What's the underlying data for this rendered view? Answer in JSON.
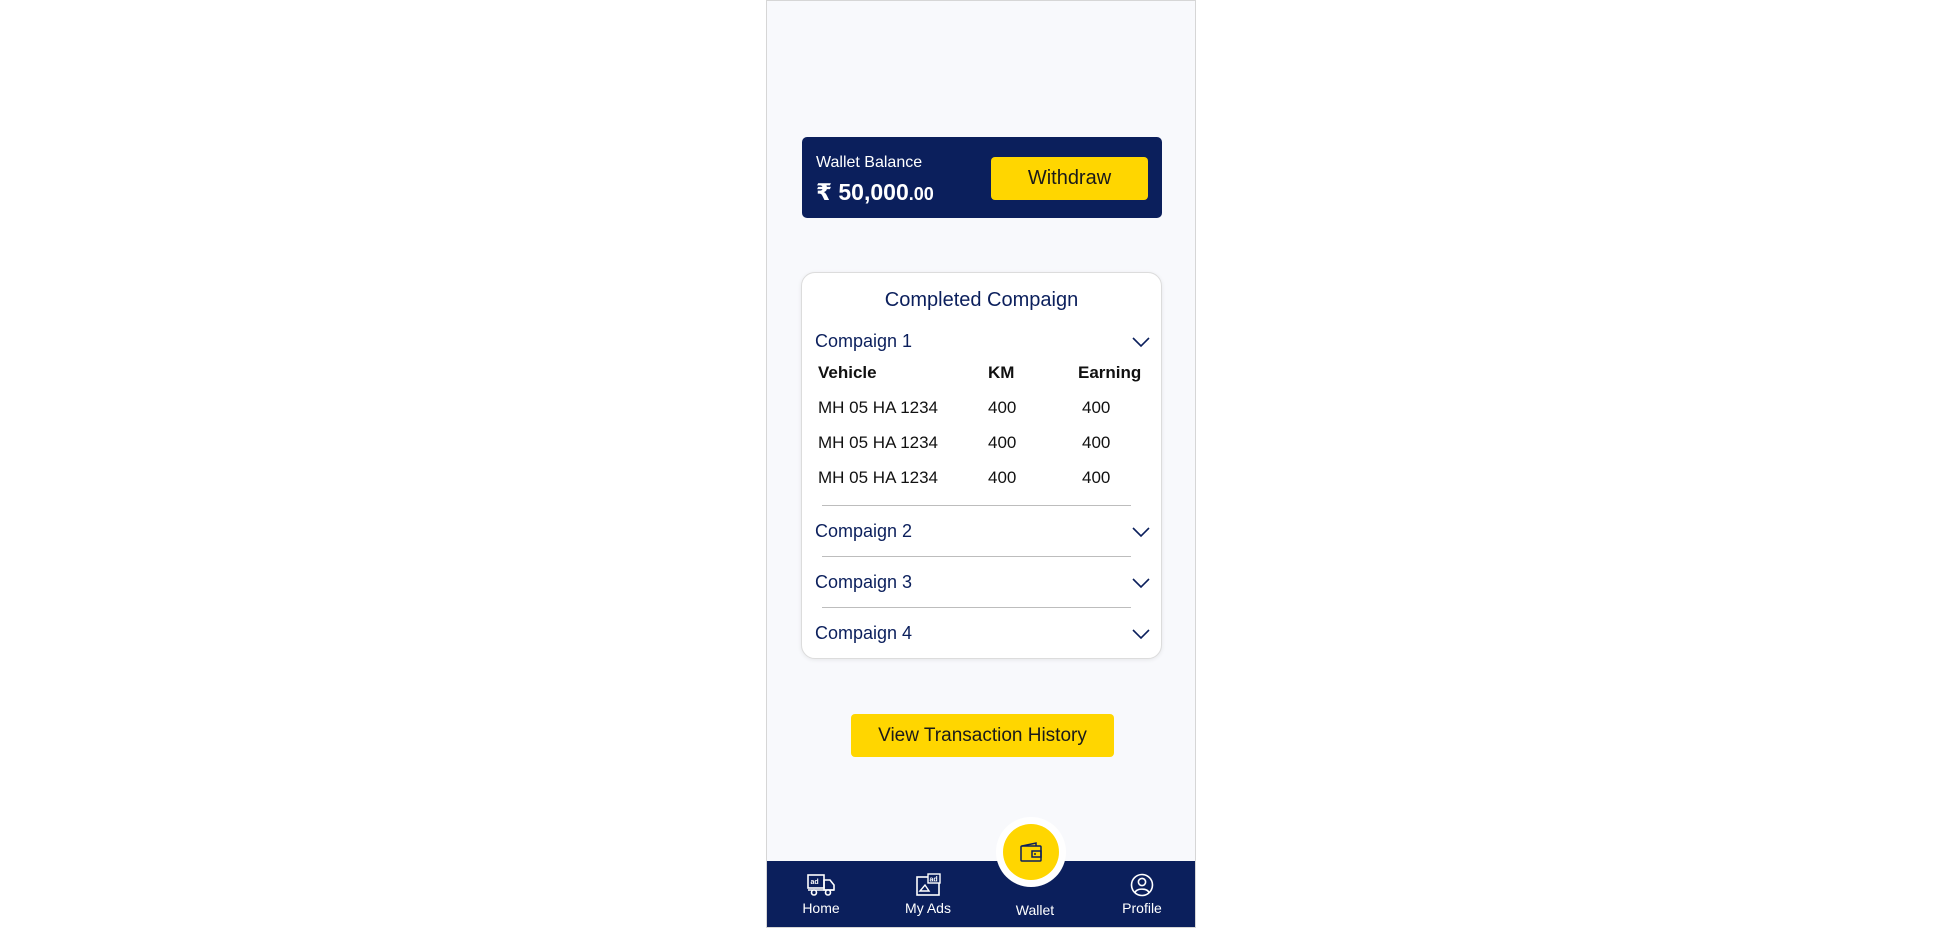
{
  "wallet": {
    "label": "Wallet Balance",
    "amount_main": "₹ 50,000",
    "amount_cents": ".00",
    "withdraw_label": "Withdraw"
  },
  "campaigns": {
    "title": "Completed Compaign",
    "items": [
      {
        "name": "Compaign 1",
        "expanded": true
      },
      {
        "name": "Compaign 2",
        "expanded": false
      },
      {
        "name": "Compaign 3",
        "expanded": false
      },
      {
        "name": "Compaign 4",
        "expanded": false
      }
    ],
    "table": {
      "headers": [
        "Vehicle",
        "KM",
        "Earning"
      ],
      "rows": [
        [
          "MH 05 HA 1234",
          "400",
          "400"
        ],
        [
          "MH 05 HA 1234",
          "400",
          "400"
        ],
        [
          "MH 05 HA 1234",
          "400",
          "400"
        ]
      ]
    }
  },
  "history_button": "View Transaction History",
  "nav": {
    "items": [
      {
        "label": "Home",
        "icon": "ad-truck-icon"
      },
      {
        "label": "My Ads",
        "icon": "ad-image-icon"
      },
      {
        "label": "Wallet",
        "icon": "wallet-icon",
        "active": true
      },
      {
        "label": "Profile",
        "icon": "profile-icon"
      }
    ]
  },
  "colors": {
    "navy": "#0b1f5c",
    "accent_yellow": "#ffd600",
    "background": "#f8f9fc"
  }
}
